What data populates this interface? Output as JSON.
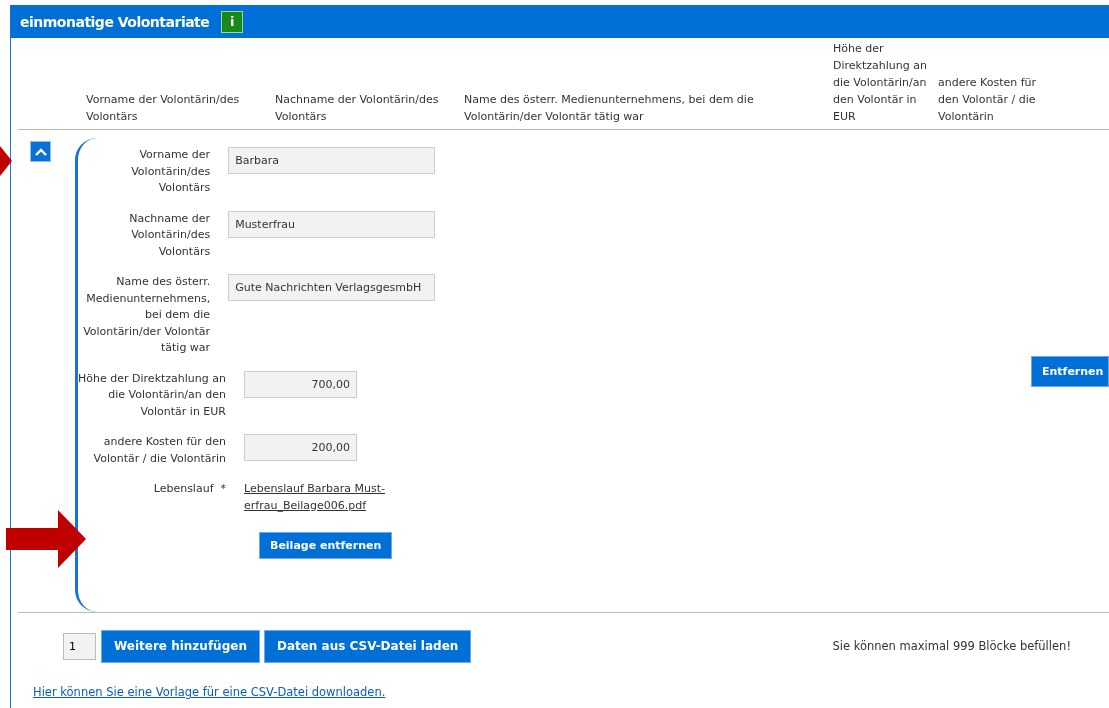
{
  "section": {
    "title": "einmonatige Volontariate",
    "info_icon": "i"
  },
  "columns": [
    "Vorname der Volontärin/des Volontärs",
    "Nachname der Volontärin/des Volontärs",
    "Name des österr. Medienunternehmens, bei dem die Volontärin/der Volontär tätig war",
    "Höhe der Direktzahlung an die Volontärin/an den Volontär in EUR",
    "andere Kosten für den Volontär / die Volontärin"
  ],
  "block": {
    "expanded": true,
    "remove_button": "Entfernen",
    "fields": [
      {
        "kind": "text",
        "label": "Vorname der Volontärin/des Volontärs",
        "value": "Barbara"
      },
      {
        "kind": "text",
        "label": "Nachname der Volontärin/des Volontärs",
        "value": "Musterfrau"
      },
      {
        "kind": "text",
        "label": "Name des österr. Medienunternehmens, bei dem die Volontärin/der Volontär tätig war",
        "value": "Gute Nachrichten VerlagsgesmbH"
      },
      {
        "kind": "number",
        "label": "Höhe der Direktzahlung an die Volontärin/an den Volontär in EUR",
        "value": "700,00"
      },
      {
        "kind": "number",
        "label": "andere Kosten für den Volontär / die Volontärin",
        "value": "200,00"
      },
      {
        "kind": "file",
        "label": "Lebenslauf",
        "required_mark": "*",
        "file": "Lebenslauf Barbara Must-erfrau_Beilage006.pdf",
        "button": "Beilage entfernen"
      }
    ]
  },
  "footer": {
    "count": "1",
    "add_button": "Weitere hinzufügen",
    "csv_button": "Daten aus CSV-Datei laden",
    "limit_note": "Sie können maximal 999 Blöcke befüllen!",
    "template_link": "Hier können Sie eine Vorlage für eine CSV-Datei downloaden."
  }
}
